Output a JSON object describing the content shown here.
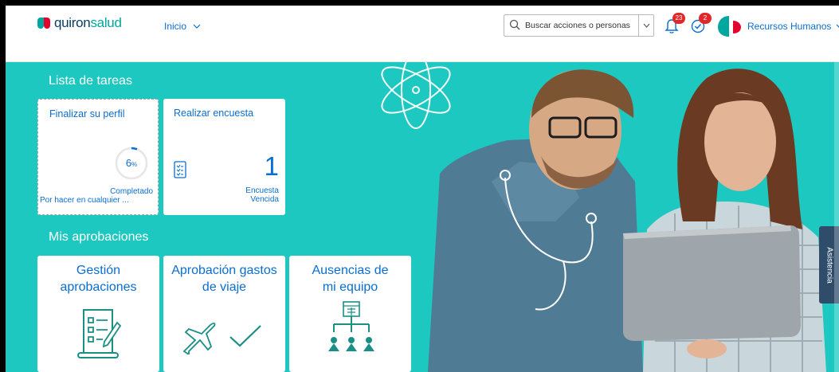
{
  "header": {
    "logo_q": "quiron",
    "logo_s": "salud",
    "nav_label": "Inicio",
    "search_placeholder": "Buscar acciones o personas",
    "notifications_count": "23",
    "approvals_count": "2",
    "user_label": "Recursos Humanos"
  },
  "tasks": {
    "section_title": "Lista de tareas",
    "profile": {
      "title": "Finalizar su perfil",
      "progress_label": "6",
      "progress_unit": "%",
      "progress_fraction": 0.06,
      "status": "Completado",
      "subtitle": "Por hacer en cualquier ..."
    },
    "survey": {
      "title": "Realizar encuesta",
      "count": "1",
      "label_line1": "Encuesta",
      "label_line2": "Vencida"
    }
  },
  "approvals": {
    "section_title": "Mis aprobaciones",
    "tiles": [
      {
        "title_line1": "Gestión",
        "title_line2": "aprobaciones"
      },
      {
        "title_line1": "Aprobación gastos",
        "title_line2": "de viaje"
      },
      {
        "title_line1": "Ausencias de",
        "title_line2": "mi equipo"
      }
    ]
  },
  "assist_label": "Asistencia",
  "colors": {
    "hero_bg": "#1cc8c0",
    "accent": "#0a6ed1",
    "brand_teal": "#00a7a0",
    "brand_red": "#e4032e",
    "badge": "#e0272a"
  }
}
